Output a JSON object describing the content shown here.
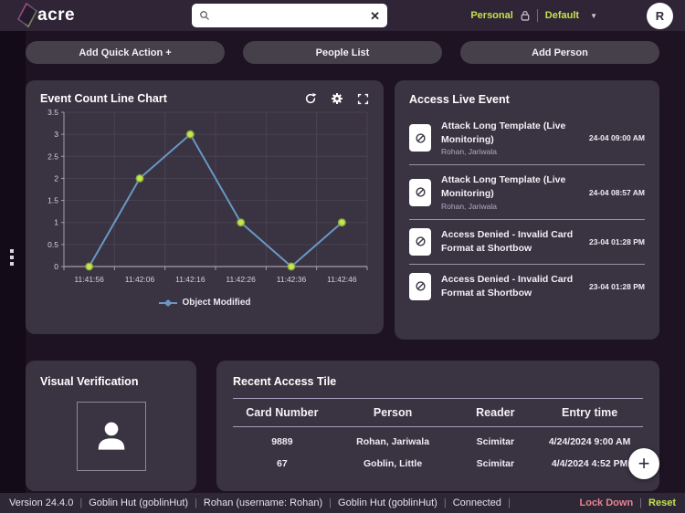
{
  "topbar": {
    "logo_text": "acre",
    "search": {
      "value": ""
    },
    "profile_label": "Personal",
    "layout_selected": "Default",
    "avatar_initial": "R",
    "clear_label": "✕"
  },
  "quick_actions": {
    "buttons": [
      {
        "label": "Add Quick Action +"
      },
      {
        "label": "People List"
      },
      {
        "label": "Add Person"
      }
    ]
  },
  "chart_data": {
    "type": "line",
    "title": "Event Count Line Chart",
    "categories": [
      "11:41:56",
      "11:42:06",
      "11:42:16",
      "11:42:26",
      "11:42:36",
      "11:42:46"
    ],
    "series": [
      {
        "name": "Object Modified",
        "values": [
          0,
          2,
          3,
          1,
          0,
          1
        ]
      }
    ],
    "xlabel": "",
    "ylabel": "",
    "ylim": [
      0,
      3.5
    ],
    "yticks": [
      0,
      0.5,
      1,
      1.5,
      2,
      2.5,
      3,
      3.5
    ],
    "grid": true,
    "legend_position": "bottom",
    "line_color": "#6a97c4",
    "marker_fill": "#c6e44f",
    "marker_stroke": "#86a83e",
    "grid_color": "#494254",
    "axis_color": "#a49db0"
  },
  "live_events": {
    "title": "Access Live Event",
    "items": [
      {
        "title": "Attack Long Template (Live Monitoring)",
        "subtitle": "Rohan, Jariwala",
        "time": "24-04 09:00 AM"
      },
      {
        "title": "Attack Long Template (Live Monitoring)",
        "subtitle": "Rohan, Jariwala",
        "time": "24-04 08:57 AM"
      },
      {
        "title": "Access Denied - Invalid Card Format at Shortbow",
        "subtitle": "",
        "time": "23-04 01:28 PM"
      },
      {
        "title": "Access Denied - Invalid Card Format at Shortbow",
        "subtitle": "",
        "time": "23-04 01:28 PM"
      }
    ]
  },
  "visual_verification": {
    "title": "Visual Verification"
  },
  "recent_access": {
    "title": "Recent Access Tile",
    "columns": [
      "Card Number",
      "Person",
      "Reader",
      "Entry time"
    ],
    "rows": [
      [
        "9889",
        "Rohan, Jariwala",
        "Scimitar",
        "4/24/2024 9:00 AM"
      ],
      [
        "67",
        "Goblin, Little",
        "Scimitar",
        "4/4/2024 4:52 PM"
      ]
    ],
    "add_label": "+"
  },
  "statusbar": {
    "items": [
      "Version 24.4.0",
      "Goblin Hut (goblinHut)",
      "Rohan (username: Rohan)",
      "Goblin Hut (goblinHut)",
      "Connected"
    ],
    "lockdown_label": "Lock Down",
    "reset_label": "Reset"
  },
  "colors": {
    "accent_green": "#c6e14d",
    "lockdown_pink": "#e8838f",
    "reset_green": "#c1e24d",
    "panel_bg": "#3a3342",
    "page_bg": "#1d1323",
    "topbar_bg": "#2f2536"
  },
  "icons": {
    "search": "magnifier",
    "clear-search": "x",
    "lock": "padlock",
    "dropdown": "chevron-down",
    "refresh": "circular-arrow",
    "settings": "gear",
    "fullscreen": "corner-brackets",
    "event": "prohibition-sign",
    "person": "person-silhouette",
    "drag-handle": "vertical-dots"
  }
}
